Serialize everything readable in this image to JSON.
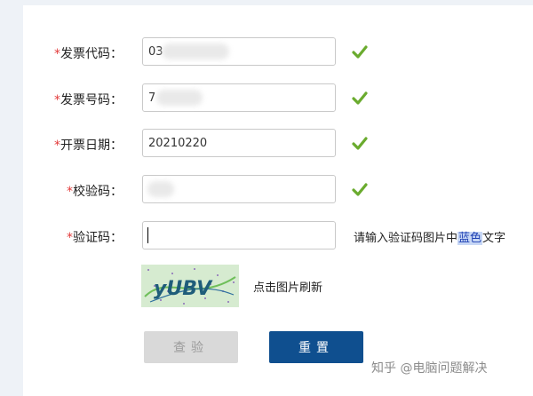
{
  "form": {
    "invoice_code": {
      "label": "发票代码：",
      "value": "03"
    },
    "invoice_number": {
      "label": "发票号码：",
      "value": "7"
    },
    "issue_date": {
      "label": "开票日期：",
      "value": "20210220"
    },
    "check_code": {
      "label": "校验码：",
      "value": ""
    },
    "captcha": {
      "label": "验证码：",
      "value": "",
      "hint_prefix": "请输入验证码图片中",
      "hint_highlight": "蓝色",
      "hint_suffix": "文字",
      "image_text": "yUBV",
      "refresh_text": "点击图片刷新"
    },
    "required_mark": "*"
  },
  "buttons": {
    "check": "查验",
    "reset": "重置"
  },
  "watermark": "知乎 @电脑问题解决",
  "colors": {
    "accent": "#0f4f8f",
    "check_green": "#6aab2e",
    "required": "#e23a3a"
  }
}
